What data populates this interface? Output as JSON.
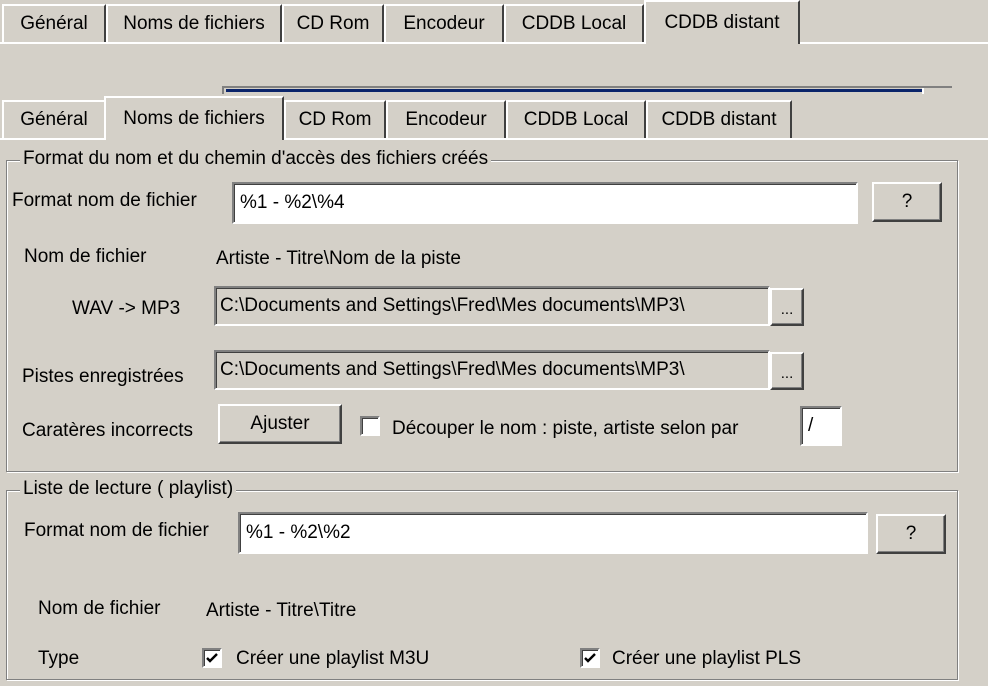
{
  "back_tabs": [
    "Général",
    "Noms de fichiers",
    "CD Rom",
    "Encodeur",
    "CDDB Local",
    "CDDB distant"
  ],
  "front_tabs": [
    "Général",
    "Noms de fichiers",
    "CD Rom",
    "Encodeur",
    "CDDB Local",
    "CDDB distant"
  ],
  "back_active_tab": "CDDB distant",
  "front_active_tab": "Noms de fichiers",
  "files_group": {
    "legend": "Format du nom et du chemin d'accès des fichiers créés",
    "format_label": "Format nom de fichier",
    "format_value": "%1 - %2\\%4",
    "help_label": "?",
    "filename_label": "Nom de fichier",
    "filename_preview": "Artiste - Titre\\Nom de la piste",
    "wav_mp3_label": "WAV -> MP3",
    "wav_mp3_path": "C:\\Documents and Settings\\Fred\\Mes documents\\MP3\\",
    "browse_label": "...",
    "recorded_label": "Pistes enregistrées",
    "recorded_path": "C:\\Documents and Settings\\Fred\\Mes documents\\MP3\\",
    "invalid_chars_label": "Caratères incorrects",
    "adjust_label": "Ajuster",
    "split_label": "Découper le nom : piste, artiste selon par",
    "split_checked": false,
    "separator_value": "/"
  },
  "playlist_group": {
    "legend": "Liste de lecture ( playlist)",
    "format_label": "Format nom de fichier",
    "format_value": "%1 - %2\\%2",
    "help_label": "?",
    "filename_label": "Nom de fichier",
    "filename_preview": "Artiste - Titre\\Titre",
    "type_label": "Type",
    "m3u_label": "Créer une playlist M3U",
    "m3u_checked": true,
    "pls_label": "Créer une playlist PLS",
    "pls_checked": true
  }
}
